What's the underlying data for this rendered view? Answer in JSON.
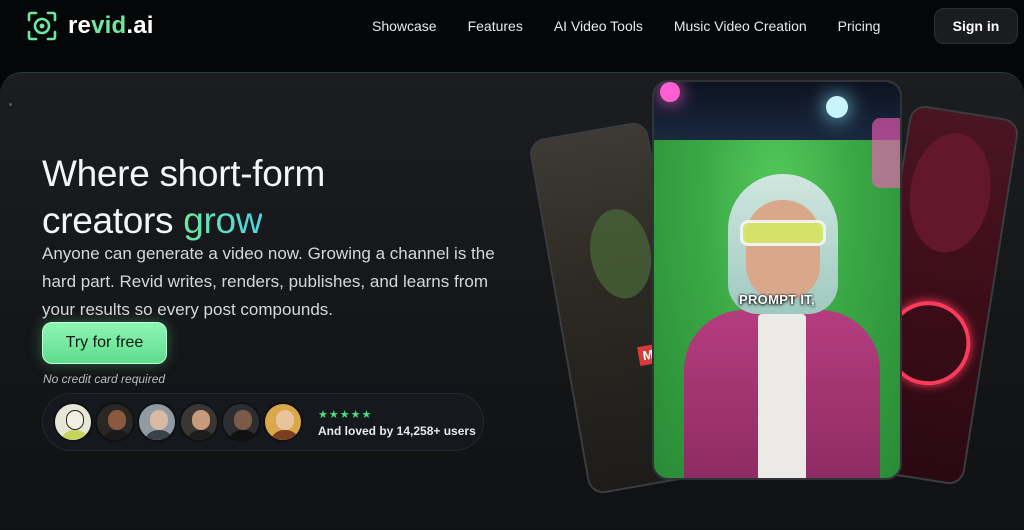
{
  "brand": {
    "name_prefix": "re",
    "name_accent": "vid",
    "name_suffix": ".ai"
  },
  "nav": {
    "links": [
      "Showcase",
      "Features",
      "AI Video Tools",
      "Music Video Creation",
      "Pricing"
    ],
    "signin_label": "Sign in"
  },
  "hero": {
    "headline_line1": "Where short-form",
    "headline_line2_prefix": "creators ",
    "headline_line2_accent": "grow",
    "description": "Anyone can generate a video now. Growing a channel is the hard part. Revid writes, renders, publishes, and learns from your results so every post compounds.",
    "cta_label": "Try for free",
    "cta_note": "No credit card required",
    "stars": "★★★★★",
    "social_proof": "And loved by 14,258+ users"
  },
  "cards": {
    "main_caption": "PROMPT IT,",
    "left_label": "Ma"
  },
  "colors": {
    "accent": "#6ee7a0",
    "cta": "#7ef0a6",
    "background": "#050607"
  }
}
